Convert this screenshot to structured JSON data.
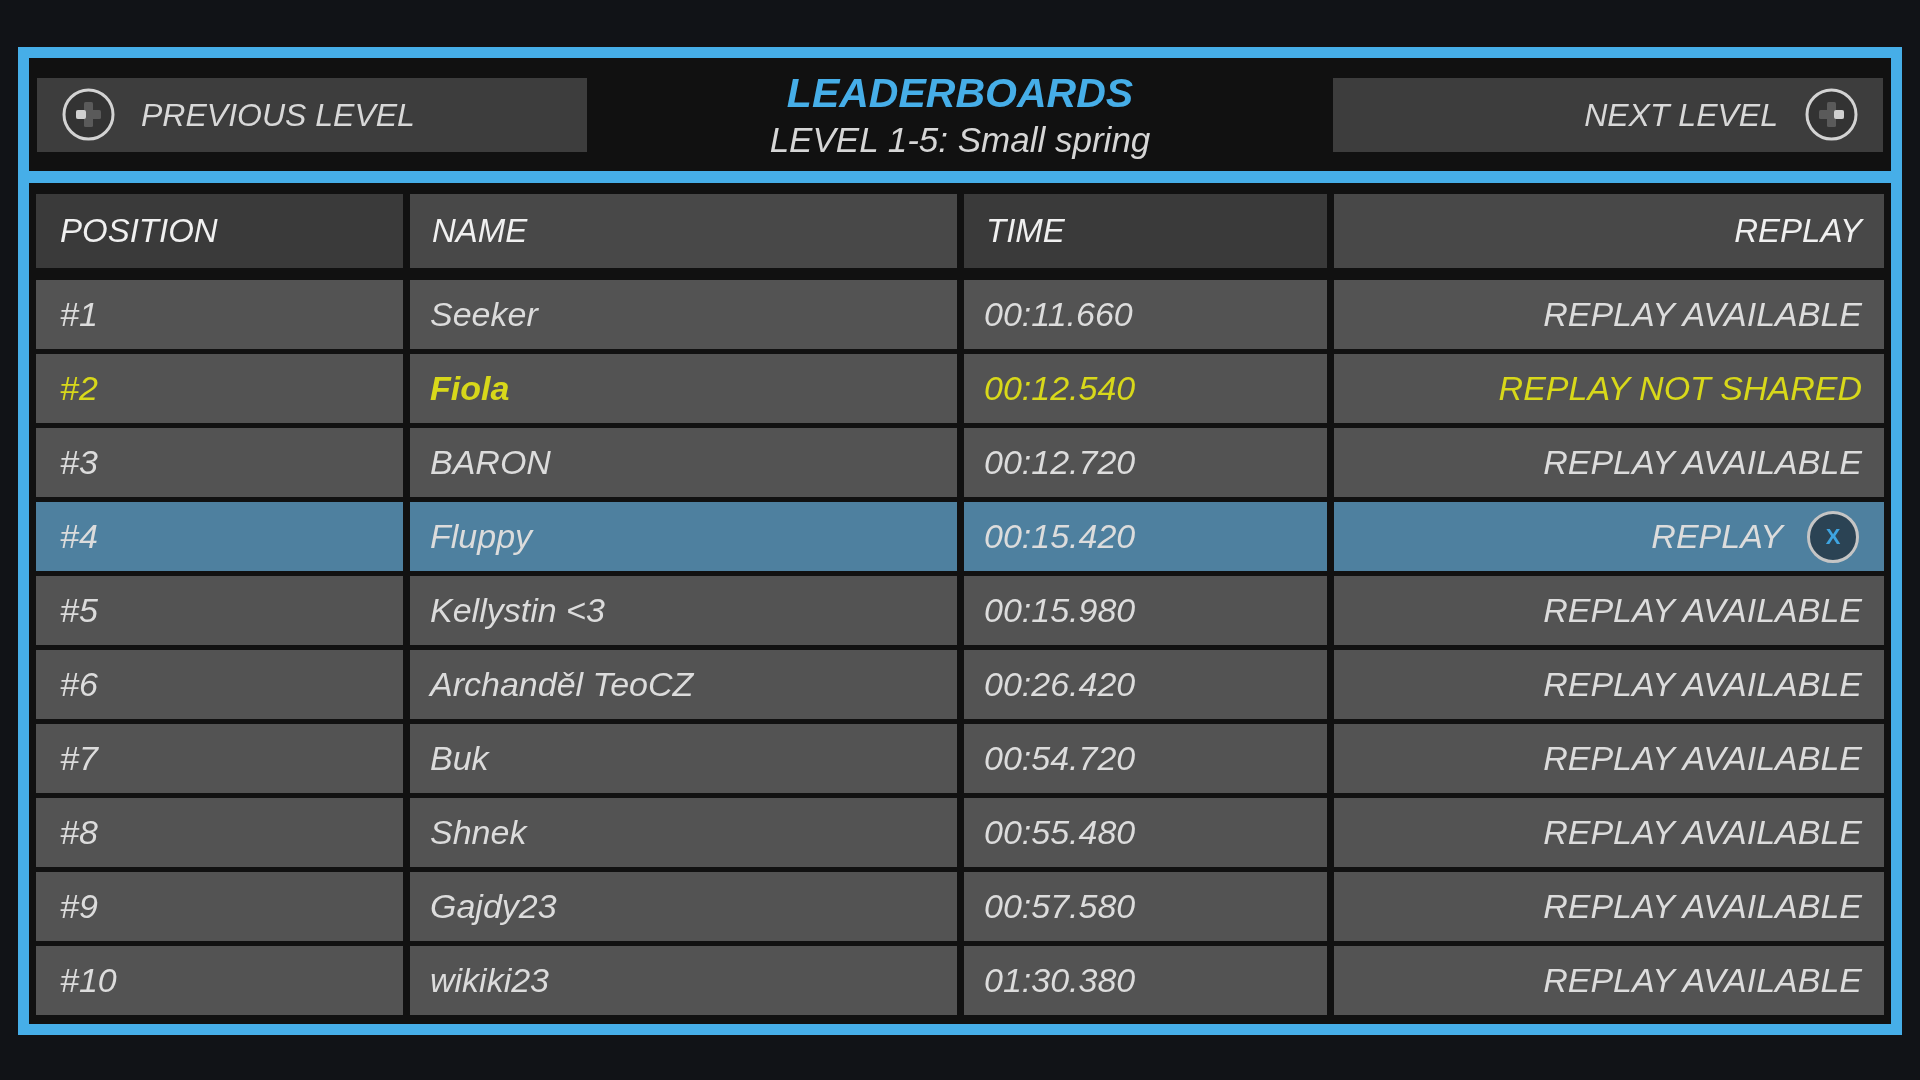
{
  "header": {
    "previous_button": {
      "label": "PREVIOUS LEVEL"
    },
    "title": "LEADERBOARDS",
    "subtitle": "LEVEL 1-5: Small spring",
    "next_button": {
      "label": "NEXT LEVEL"
    }
  },
  "table": {
    "columns": [
      "POSITION",
      "NAME",
      "TIME",
      "REPLAY"
    ],
    "rows": [
      {
        "position": "#1",
        "name": "Seeker",
        "time": "00:11.660",
        "replay": "REPLAY AVAILABLE",
        "selected": false,
        "highlighted": false
      },
      {
        "position": "#2",
        "name": "Fiola",
        "time": "00:12.540",
        "replay": "REPLAY NOT SHARED",
        "selected": false,
        "highlighted": true
      },
      {
        "position": "#3",
        "name": "BARON",
        "time": "00:12.720",
        "replay": "REPLAY AVAILABLE",
        "selected": false,
        "highlighted": false
      },
      {
        "position": "#4",
        "name": "Fluppy",
        "time": "00:15.420",
        "replay": "REPLAY",
        "replay_button": "X",
        "selected": true,
        "highlighted": false
      },
      {
        "position": "#5",
        "name": "Kellystin <3",
        "time": "00:15.980",
        "replay": "REPLAY AVAILABLE",
        "selected": false,
        "highlighted": false
      },
      {
        "position": "#6",
        "name": "Archanděl TeoCZ",
        "time": "00:26.420",
        "replay": "REPLAY AVAILABLE",
        "selected": false,
        "highlighted": false
      },
      {
        "position": "#7",
        "name": "Buk",
        "time": "00:54.720",
        "replay": "REPLAY AVAILABLE",
        "selected": false,
        "highlighted": false
      },
      {
        "position": "#8",
        "name": "Shnek",
        "time": "00:55.480",
        "replay": "REPLAY AVAILABLE",
        "selected": false,
        "highlighted": false
      },
      {
        "position": "#9",
        "name": "Gajdy23",
        "time": "00:57.580",
        "replay": "REPLAY AVAILABLE",
        "selected": false,
        "highlighted": false
      },
      {
        "position": "#10",
        "name": "wikiki23",
        "time": "01:30.380",
        "replay": "REPLAY AVAILABLE",
        "selected": false,
        "highlighted": false
      }
    ]
  }
}
